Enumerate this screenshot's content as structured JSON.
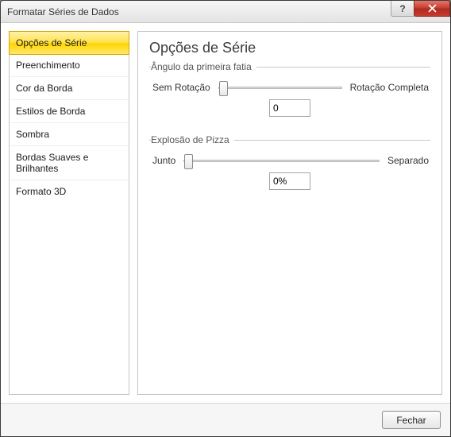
{
  "window": {
    "title": "Formatar Séries de Dados"
  },
  "nav": {
    "items": [
      {
        "label": "Opções de Série",
        "selected": true
      },
      {
        "label": "Preenchimento",
        "selected": false
      },
      {
        "label": "Cor da Borda",
        "selected": false
      },
      {
        "label": "Estilos de Borda",
        "selected": false
      },
      {
        "label": "Sombra",
        "selected": false
      },
      {
        "label": "Bordas Suaves e Brilhantes",
        "selected": false
      },
      {
        "label": "Formato 3D",
        "selected": false
      }
    ]
  },
  "content": {
    "heading": "Opções de Série",
    "groups": {
      "angle": {
        "legend": "Ângulo da primeira fatia",
        "min_label": "Sem Rotação",
        "max_label": "Rotação Completa",
        "value": "0"
      },
      "explosion": {
        "legend": "Explosão de Pizza",
        "min_label": "Junto",
        "max_label": "Separado",
        "value": "0%"
      }
    }
  },
  "footer": {
    "close_label": "Fechar"
  },
  "titlebar": {
    "help_symbol": "?"
  }
}
